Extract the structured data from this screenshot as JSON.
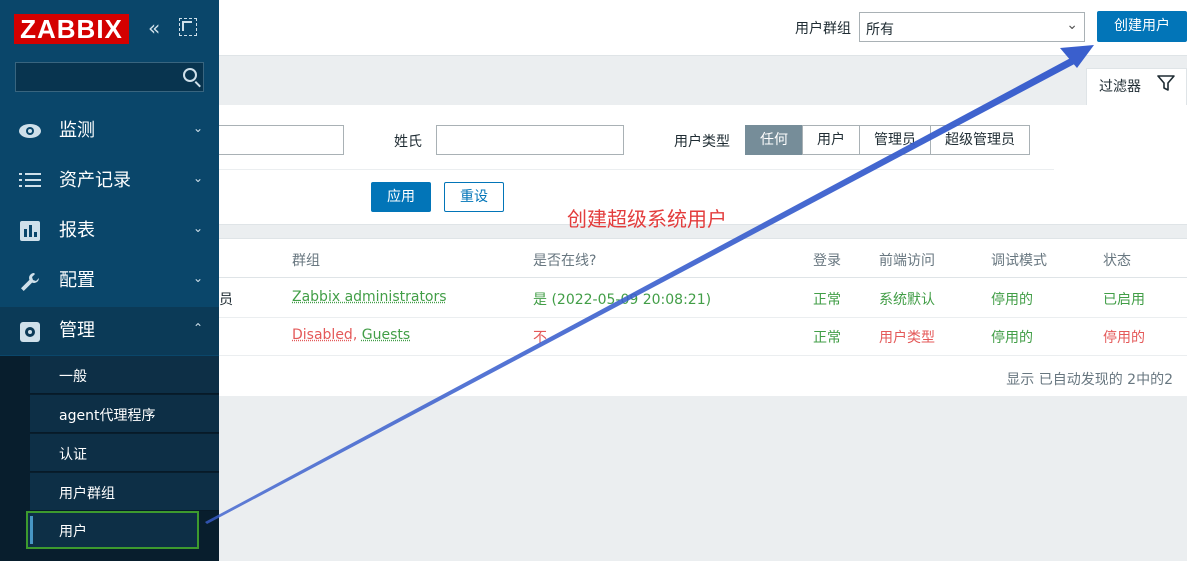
{
  "brand": {
    "logo_text": "ZABBIX",
    "accent": "#d40000"
  },
  "sidebar": {
    "menu": [
      {
        "label": "监测",
        "icon": "eye-icon"
      },
      {
        "label": "资产记录",
        "icon": "list-icon"
      },
      {
        "label": "报表",
        "icon": "bar-chart-icon"
      },
      {
        "label": "配置",
        "icon": "wrench-icon"
      },
      {
        "label": "管理",
        "icon": "gear-icon"
      }
    ],
    "submenu": [
      {
        "label": "一般"
      },
      {
        "label": "agent代理程序"
      },
      {
        "label": "认证"
      },
      {
        "label": "用户群组"
      },
      {
        "label": "用户"
      }
    ]
  },
  "header": {
    "group_label": "用户群组",
    "group_value": "所有",
    "create_button": "创建用户"
  },
  "filter": {
    "tab_label": "过滤器",
    "surname_label": "姓氏",
    "usertype_label": "用户类型",
    "usertype_options": [
      "任何",
      "用户",
      "管理员",
      "超级管理员"
    ],
    "apply": "应用",
    "reset": "重设"
  },
  "annotation": "创建超级系统用户",
  "table": {
    "headers": [
      "群组",
      "是否在线?",
      "登录",
      "前端访问",
      "调试模式",
      "状态"
    ],
    "rows": [
      {
        "alias_tail": "员",
        "groups": [
          {
            "name": "Zabbix administrators",
            "color": "green"
          }
        ],
        "online": "是 (2022-05-09 20:08:21)",
        "login": "正常",
        "frontend": "系统默认",
        "debug": "停用的",
        "status": "已启用"
      },
      {
        "alias_tail": "",
        "groups": [
          {
            "name": "Disabled",
            "color": "red"
          },
          {
            "name": "Guests",
            "color": "green"
          }
        ],
        "online": "不",
        "login": "正常",
        "frontend": "用户类型",
        "debug": "停用的",
        "status": "停用的"
      }
    ],
    "footer": "显示 已自动发现的 2中的2"
  }
}
